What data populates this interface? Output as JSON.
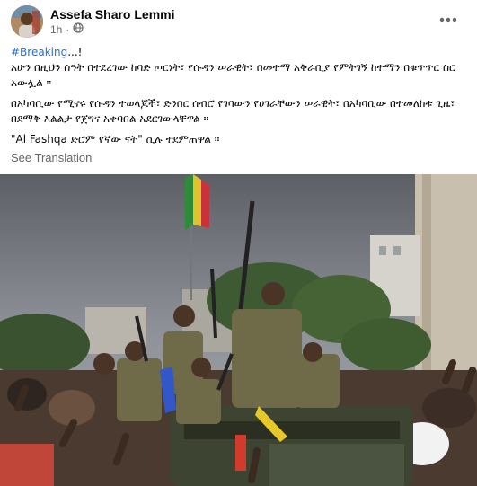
{
  "post": {
    "author": "Assefa Sharo Lemmi",
    "time": "1h",
    "hashtag": "#Breaking",
    "hashtag_suffix": "...!",
    "line1": "አሁን በዚህን ሰዓት በተደረገው ከባድ ጦርነት፣ የሱዳን ሠራዊት፣ በመተማ አቅራቢያ የምትገኝ ከተማን በቁጥጥር ስር አውሏል ።",
    "paragraph2": "በአካባቢው የሚኖሩ የሱዳን ተወላጆች፣ ድንበር ሰብሮ የገባውን የሀገራቸውን ሠራዊት፣ በአካባቢው በተመለከቱ ጊዜ፣ በደማቅ እልልታ የጀግና አቀባበል አደርገውላቸዋል ።",
    "paragraph3": "\"Al Fashqa ድሮም የኛው ናት\" ሲሉ ተደምጠዋል ።",
    "see_translation": "See Translation"
  },
  "icons": {
    "more": "more-options-icon",
    "privacy": "globe-icon"
  },
  "colors": {
    "link": "#216fdb",
    "secondary_text": "#65676b",
    "primary_text": "#050505"
  }
}
